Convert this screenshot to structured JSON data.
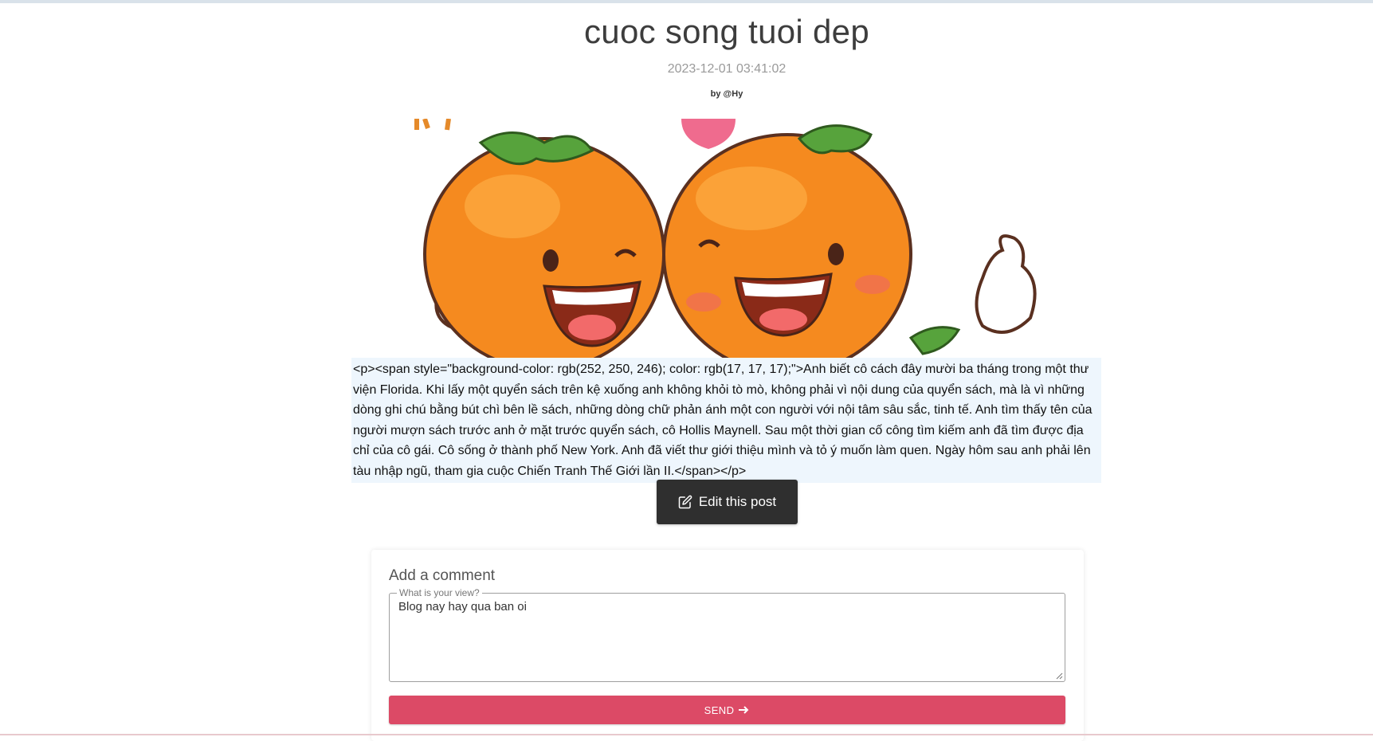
{
  "post": {
    "title": "cuoc song tuoi dep",
    "date": "2023-12-01 03:41:02",
    "author": "by @Hy",
    "image_icon": "oranges-cartoon-image",
    "body": "<p><span style=\"background-color: rgb(252, 250, 246); color: rgb(17, 17, 17);\">Anh biết cô cách đây mười ba tháng trong một thư viện Florida. Khi lấy một quyển sách trên kệ xuống anh không khỏi tò mò, không phải vì nội dung của quyển sách, mà là vì những dòng ghi chú bằng bút chì bên lề sách, những dòng chữ phản ánh một con người với nội tâm sâu sắc, tinh tế. Anh tìm thấy tên của người mượn sách trước anh ở mặt trước quyển sách, cô Hollis Maynell. Sau một thời gian cố công tìm kiếm anh đã tìm được địa chỉ của cô gái. Cô sống ở thành phố New York. Anh đã viết thư giới thiệu mình và tỏ ý muốn làm quen. Ngày hôm sau anh phải lên tàu nhập ngũ, tham gia cuộc Chiến Tranh Thế Giới lần II.</span></p>",
    "edit_label": "Edit this post"
  },
  "comment": {
    "heading": "Add a comment",
    "field_label": "What is your view?",
    "field_value": "Blog nay hay qua ban oi",
    "send_label": "SEND"
  },
  "colors": {
    "send_button": "#dc4a66",
    "edit_button": "#2f2f2f",
    "body_background": "#eef6fd"
  }
}
